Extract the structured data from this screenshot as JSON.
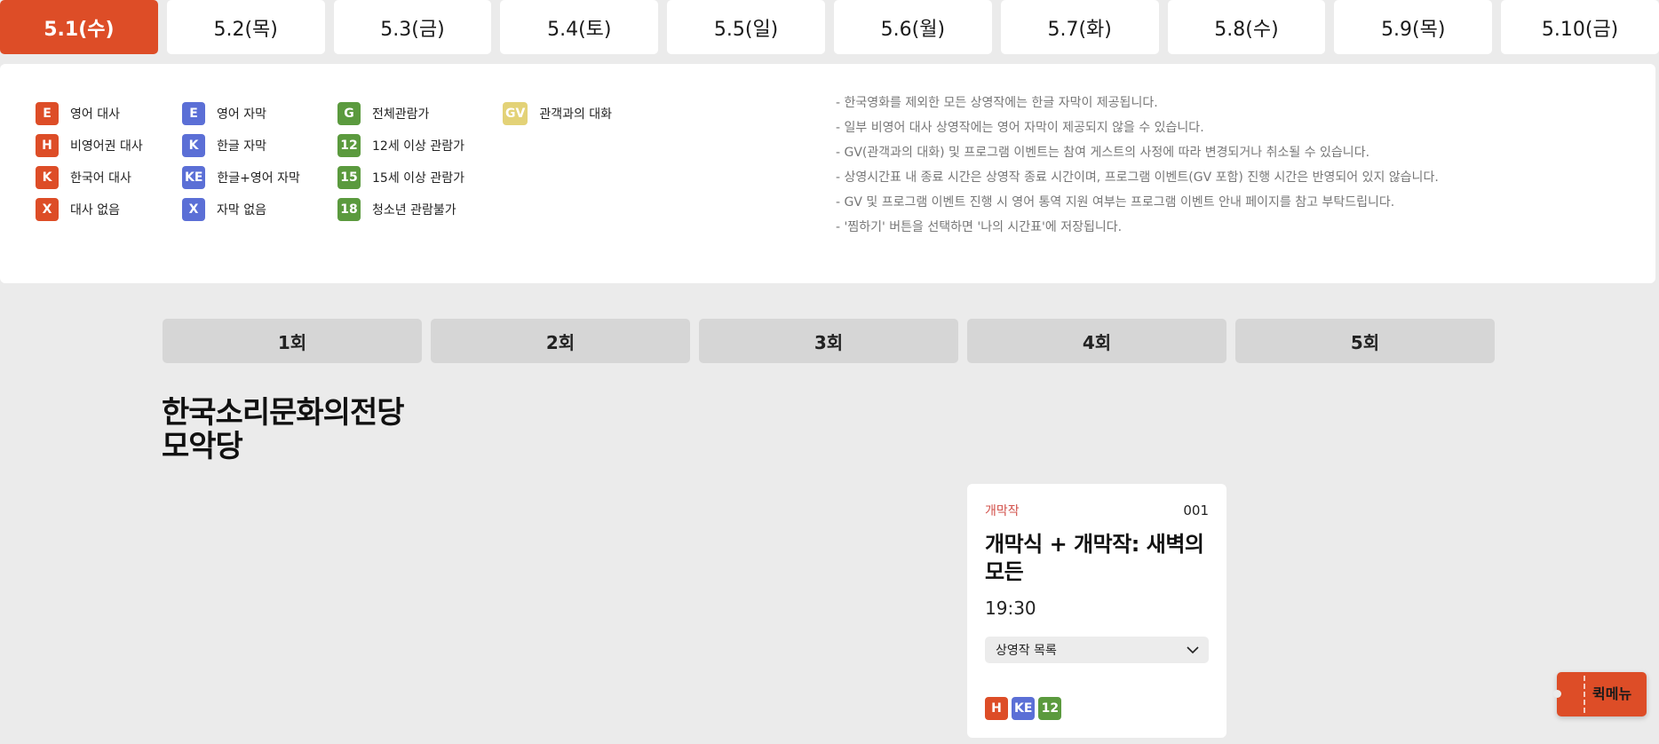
{
  "colors": {
    "accent": "#dd4d27",
    "dialogue": "#dd4d27",
    "subtitle": "#5b6fd6",
    "rating": "#5b9a3e",
    "gv": "#e3d277"
  },
  "date_tabs": [
    {
      "label": "5.1(수)",
      "active": true
    },
    {
      "label": "5.2(목)",
      "active": false
    },
    {
      "label": "5.3(금)",
      "active": false
    },
    {
      "label": "5.4(토)",
      "active": false
    },
    {
      "label": "5.5(일)",
      "active": false
    },
    {
      "label": "5.6(월)",
      "active": false
    },
    {
      "label": "5.7(화)",
      "active": false
    },
    {
      "label": "5.8(수)",
      "active": false
    },
    {
      "label": "5.9(목)",
      "active": false
    },
    {
      "label": "5.10(금)",
      "active": false
    }
  ],
  "legend": {
    "dialogue": [
      {
        "code": "E",
        "label": "영어 대사"
      },
      {
        "code": "H",
        "label": "비영어권 대사"
      },
      {
        "code": "K",
        "label": "한국어 대사"
      },
      {
        "code": "X",
        "label": "대사 없음"
      }
    ],
    "subtitles": [
      {
        "code": "E",
        "label": "영어 자막"
      },
      {
        "code": "K",
        "label": "한글 자막"
      },
      {
        "code": "KE",
        "label": "한글+영어 자막"
      },
      {
        "code": "X",
        "label": "자막 없음"
      }
    ],
    "ratings": [
      {
        "code": "G",
        "label": "전체관람가"
      },
      {
        "code": "12",
        "label": "12세 이상 관람가"
      },
      {
        "code": "15",
        "label": "15세 이상 관람가"
      },
      {
        "code": "18",
        "label": "청소년 관람불가"
      }
    ],
    "events": [
      {
        "code": "GV",
        "label": "관객과의 대화"
      }
    ]
  },
  "notes": [
    "- 한국영화를 제외한 모든 상영작에는 한글 자막이 제공됩니다.",
    "- 일부 비영어 대사 상영작에는 영어 자막이 제공되지 않을 수 있습니다.",
    "- GV(관객과의 대화) 및 프로그램 이벤트는 참여 게스트의 사정에 따라 변경되거나 취소될 수 있습니다.",
    "- 상영시간표 내 종료 시간은 상영작 종료 시간이며, 프로그램 이벤트(GV 포함) 진행 시간은 반영되어 있지 않습니다.",
    "- GV 및 프로그램 이벤트 진행 시 영어 통역 지원 여부는 프로그램 이벤트 안내 페이지를 참고 부탁드립니다.",
    "- '찜하기' 버튼을 선택하면 '나의 시간표'에 저장됩니다."
  ],
  "session_tabs": [
    "1회",
    "2회",
    "3회",
    "4회",
    "5회"
  ],
  "venue": {
    "name_line1": "한국소리문화의전당",
    "name_line2": "모악당"
  },
  "screening": {
    "category": "개막작",
    "code": "001",
    "title_line1": "개막식 + 개막작: 새벽의",
    "title_line2": "모든",
    "time": "19:30",
    "film_list_label": "상영작 목록",
    "badges": [
      {
        "code": "H",
        "kind": "dialogue"
      },
      {
        "code": "KE",
        "kind": "subtitle"
      },
      {
        "code": "12",
        "kind": "rating"
      }
    ]
  },
  "quick_menu": {
    "label": "퀵메뉴"
  }
}
